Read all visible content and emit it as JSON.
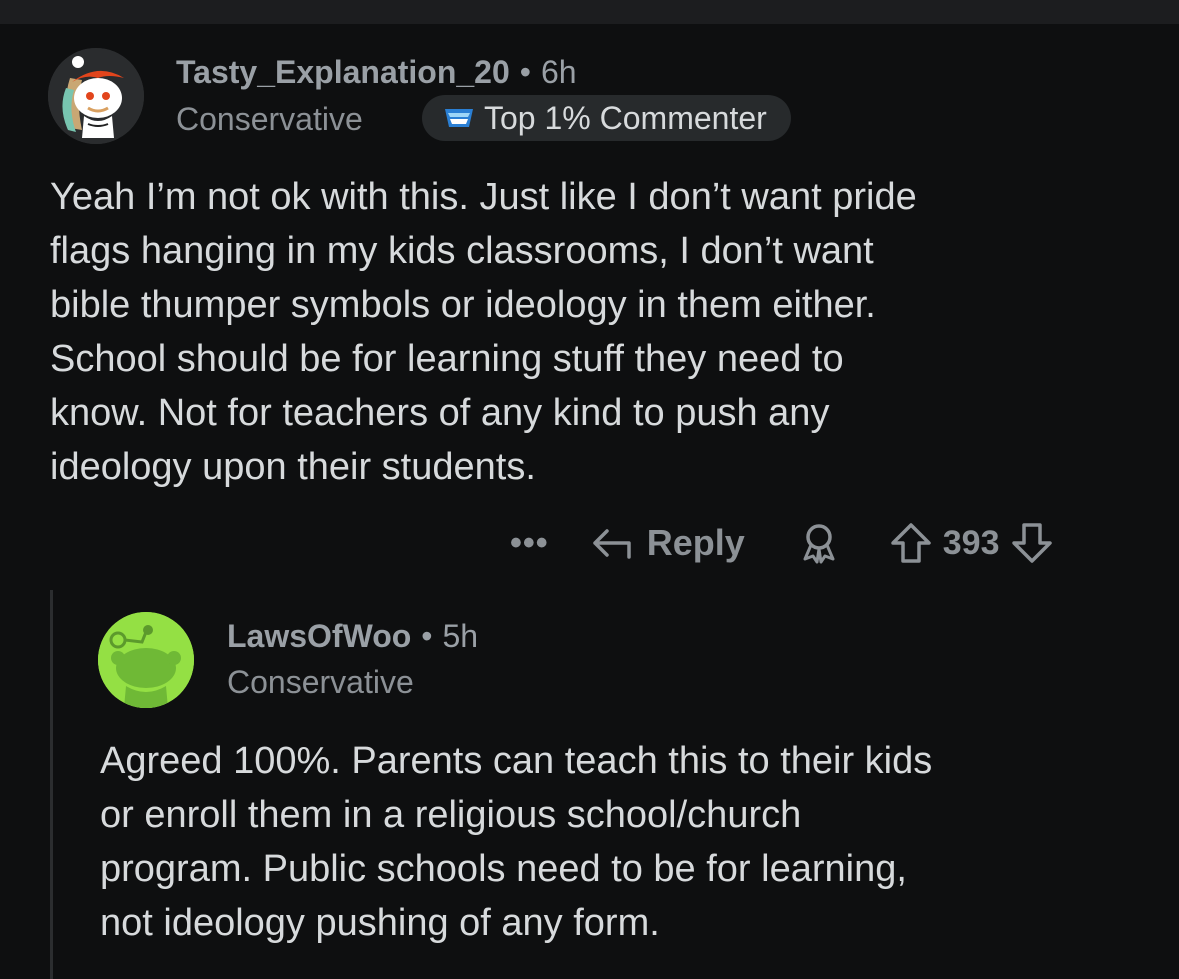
{
  "comment1": {
    "username": "Tasty_Explanation_20",
    "separator": "•",
    "time": "6h",
    "flair": "Conservative",
    "badge_label": "Top 1% Commenter",
    "body": [
      "Yeah I’m not ok with this. Just like I don’t want pride",
      "flags hanging in my kids classrooms, I don’t want",
      "bible thumper symbols or ideology in them either.",
      "School should be for learning stuff they need to",
      "know. Not for teachers of any kind to push any",
      "ideology upon their students."
    ],
    "actions": {
      "more_label": "•••",
      "reply_label": "Reply",
      "score": "393"
    }
  },
  "comment2": {
    "username": "LawsOfWoo",
    "separator": "•",
    "time": "5h",
    "flair": "Conservative",
    "body": [
      "Agreed 100%. Parents can teach this to their kids",
      "or enroll them in a religious school/church",
      "program. Public schools need to be for learning,",
      "not ideology pushing of any form."
    ]
  },
  "colors": {
    "background": "#0e0f10",
    "text": "#d7dadc",
    "muted": "#8c9196",
    "badge_bg": "#272a2c",
    "avatar2_bg": "#94e044"
  },
  "icons": [
    "avatar-snoo-icon",
    "top-commenter-badge-icon",
    "reply-arrow-icon",
    "award-icon",
    "upvote-icon",
    "downvote-icon"
  ]
}
